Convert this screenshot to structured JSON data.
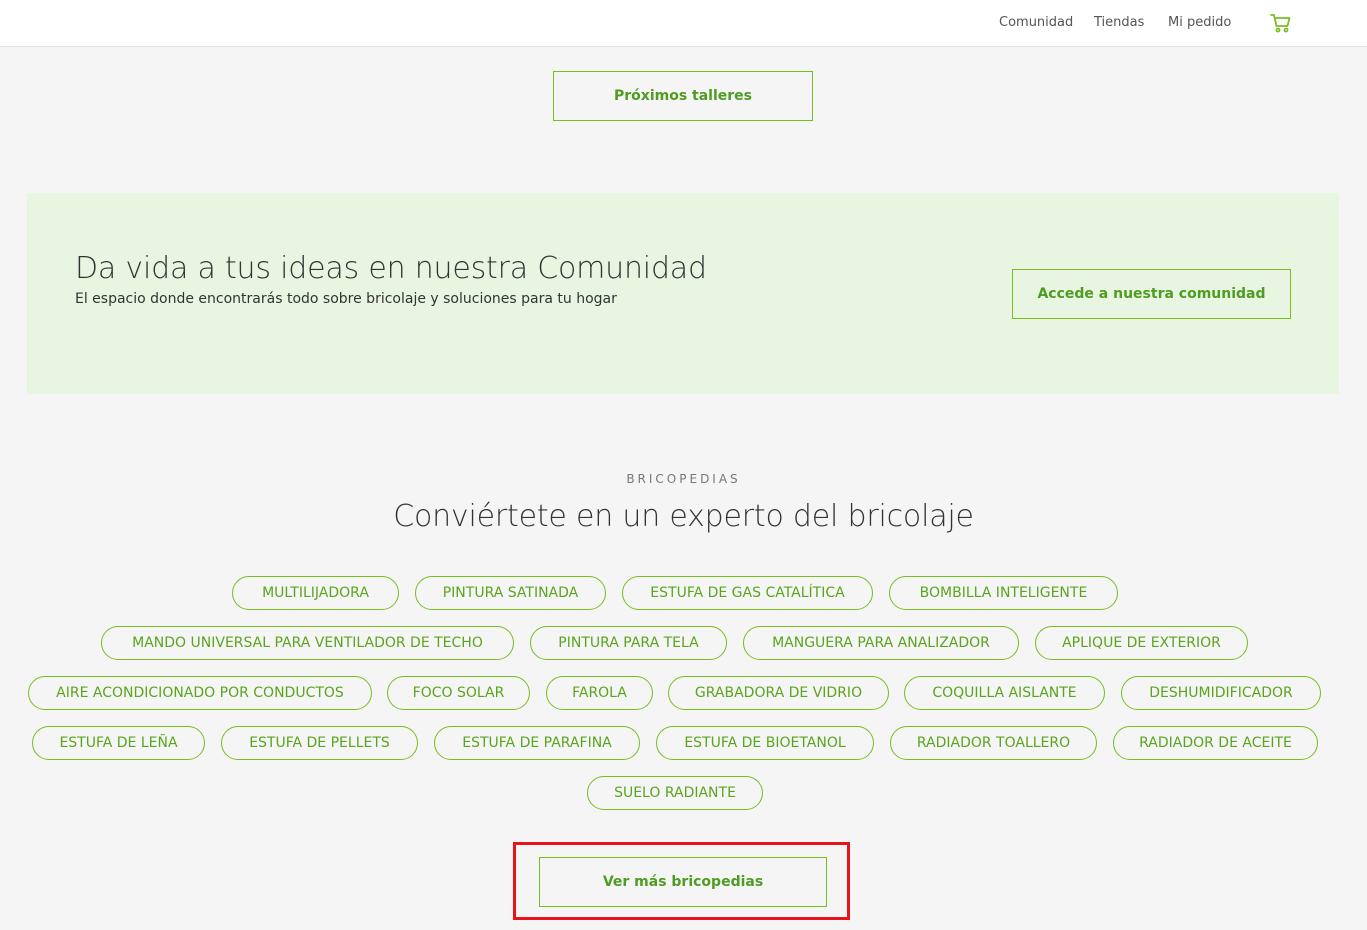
{
  "header": {
    "nav": [
      "Comunidad",
      "Tiendas",
      "Mi pedido"
    ],
    "cart_icon": "cart-icon"
  },
  "workshops": {
    "button_label": "Próximos talleres"
  },
  "community": {
    "title": "Da vida a tus ideas en nuestra Comunidad",
    "subtitle": "El espacio donde encontrarás todo sobre bricolaje y soluciones para tu hogar",
    "button_label": "Accede a nuestra comunidad"
  },
  "bricopedias": {
    "eyebrow": "BRICOPEDIAS",
    "title": "Conviértete en un experto del bricolaje",
    "tags": [
      "MULTILIJADORA",
      "PINTURA SATINADA",
      "ESTUFA DE GAS CATALÍTICA",
      "BOMBILLA INTELIGENTE",
      "MANDO UNIVERSAL PARA VENTILADOR DE TECHO",
      "PINTURA PARA TELA",
      "MANGUERA PARA ANALIZADOR",
      "APLIQUE DE EXTERIOR",
      "AIRE ACONDICIONADO POR CONDUCTOS",
      "FOCO SOLAR",
      "FAROLA",
      "GRABADORA DE VIDRIO",
      "COQUILLA AISLANTE",
      "DESHUMIDIFICADOR",
      "ESTUFA DE LEÑA",
      "ESTUFA DE PELLETS",
      "ESTUFA DE PARAFINA",
      "ESTUFA DE BIOETANOL",
      "RADIADOR TOALLERO",
      "RADIADOR DE ACEITE",
      "SUELO RADIANTE"
    ],
    "more_button_label": "Ver más bricopedias"
  },
  "colors": {
    "accent": "#78be20",
    "text_accent": "#5aa51e",
    "banner_bg": "#e8f5e0",
    "highlight": "#e8141c"
  }
}
